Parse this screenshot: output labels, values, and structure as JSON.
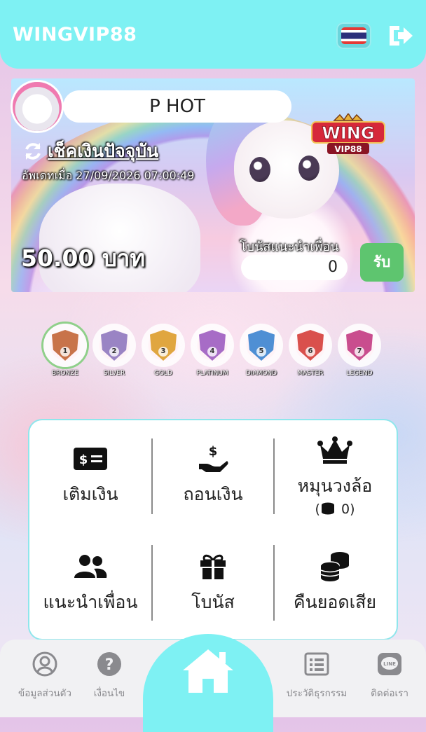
{
  "header": {
    "brand": "WINGVIP88",
    "language_flag": "thailand-flag-icon",
    "logout_icon": "logout-icon"
  },
  "banner": {
    "username": "P HOT",
    "check_balance_label": "เช็คเงินปัจจุบัน",
    "updated_text": "อัพเดทเมื่อ 27/09/2026 07:00:49",
    "balance": "50.00 บาท",
    "referral_bonus_label": "โบนัสแนะนำเพื่อน",
    "referral_bonus_value": "0",
    "claim_label": "รับ",
    "logo_text": "WING",
    "logo_subtext": "VIP88"
  },
  "tiers": [
    {
      "name": "BRONZE",
      "number": "1",
      "color": "#c8734a"
    },
    {
      "name": "SILVER",
      "number": "2",
      "color": "#9a84c4"
    },
    {
      "name": "GOLD",
      "number": "3",
      "color": "#e0a640"
    },
    {
      "name": "PLATINUM",
      "number": "4",
      "color": "#a76cc6"
    },
    {
      "name": "DIAMOND",
      "number": "5",
      "color": "#4f8fd4"
    },
    {
      "name": "MASTER",
      "number": "6",
      "color": "#d9504c"
    },
    {
      "name": "LEGEND",
      "number": "7",
      "color": "#c94d8e"
    }
  ],
  "menu": {
    "deposit": "เติมเงิน",
    "withdraw": "ถอนเงิน",
    "wheel": "หมุนวงล้อ",
    "wheel_coins": "0",
    "refer": "แนะนำเพื่อน",
    "bonus": "โบนัส",
    "cashback": "คืนยอดเสีย"
  },
  "bottom_nav": {
    "profile": "ข้อมูลส่วนตัว",
    "terms": "เงื่อนไข",
    "history": "ประวัติธุรกรรม",
    "contact": "ติดต่อเรา",
    "line_label": "LINE"
  },
  "colors": {
    "header_bg": "#7ef1f3",
    "claim_green": "#5ec56f",
    "nav_text": "#8a8a8e"
  }
}
